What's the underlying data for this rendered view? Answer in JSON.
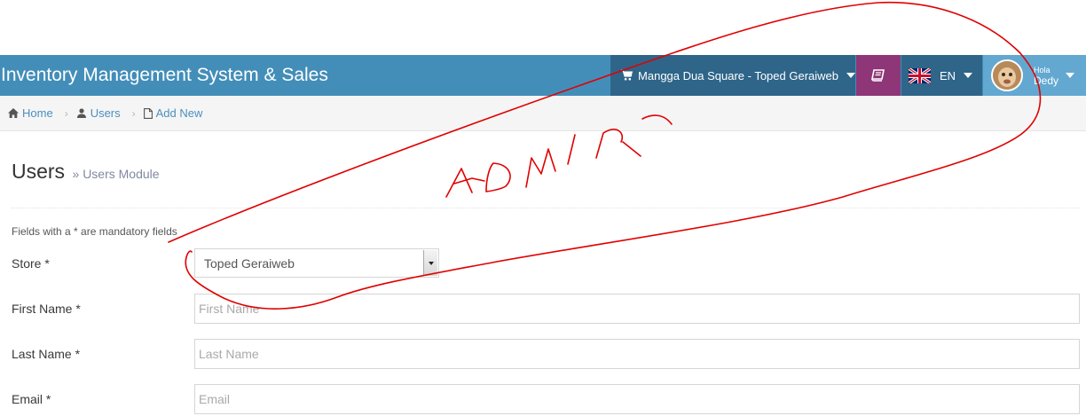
{
  "header": {
    "app_title": "Inventory Management System & Sales",
    "store_label": "Mangga Dua Square - Toped Geraiweb",
    "language": "EN",
    "user_greeting": "Hola",
    "user_name": "Dedy"
  },
  "breadcrumbs": [
    {
      "label": "Home",
      "icon": "home-icon"
    },
    {
      "label": "Users",
      "icon": "users-icon"
    },
    {
      "label": "Add New",
      "icon": "file-icon"
    }
  ],
  "page": {
    "title": "Users",
    "subtitle": "» Users Module",
    "mandatory_note": "Fields with a * are mandatory fields"
  },
  "form": {
    "store": {
      "label": "Store *",
      "value": "Toped Geraiweb"
    },
    "first_name": {
      "label": "First Name *",
      "placeholder": "First Name"
    },
    "last_name": {
      "label": "Last Name *",
      "placeholder": "Last Name"
    },
    "email": {
      "label": "Email *",
      "placeholder": "Email"
    }
  },
  "colors": {
    "navbar": "#438eb9",
    "store_dropdown": "#2e6589",
    "book_button": "#8e3677",
    "user_box": "#62a8d1",
    "annotation": "#e00000"
  }
}
